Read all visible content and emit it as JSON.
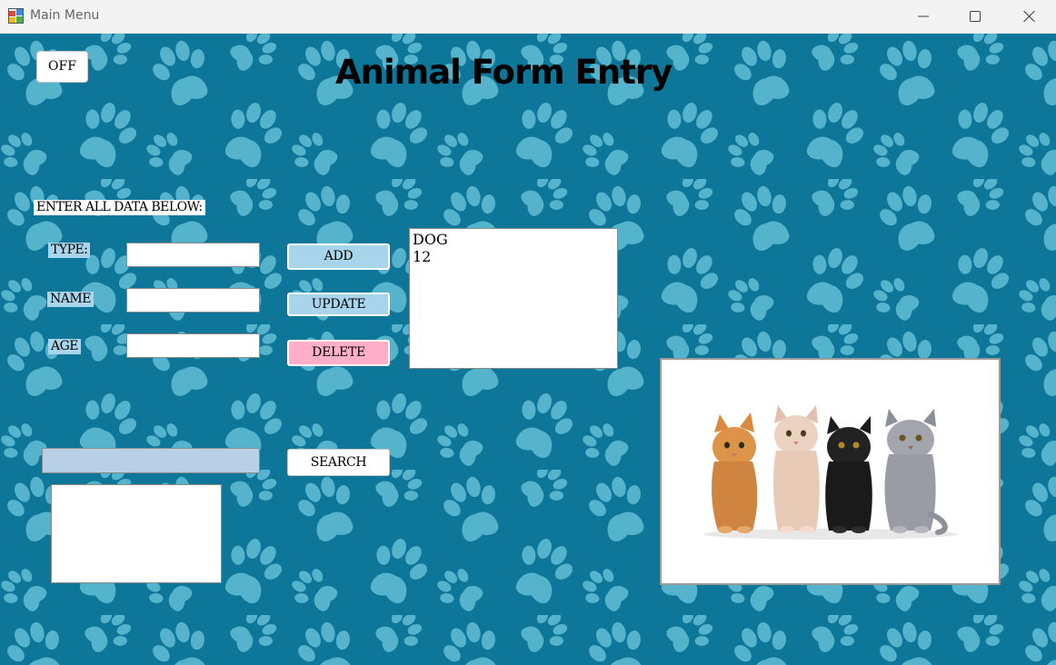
{
  "window": {
    "title": "Main Menu",
    "app_icon": "winforms-app-icon",
    "controls": [
      "minimize-icon",
      "maximize-icon",
      "close-icon"
    ]
  },
  "form": {
    "heading": "Animal Form Entry",
    "off_label": "OFF",
    "instruction": "ENTER ALL DATA BELOW:",
    "labels": {
      "type": "TYPE:",
      "name": "NAME",
      "age": "AGE"
    },
    "fields": {
      "type": "",
      "name": "",
      "age": ""
    },
    "buttons": {
      "add": "ADD",
      "update": "UPDATE",
      "delete": "DELETE",
      "search": "SEARCH"
    },
    "list_items": [
      "DOG",
      "12"
    ],
    "search_value": "",
    "picture": "kittens-photo"
  },
  "colors": {
    "background": "#0d7699",
    "paw": "#55b3cb",
    "label_bg": "#a8d5ec",
    "button_primary": "#a8d5ec",
    "button_delete": "#ffafc8",
    "search_input": "#b8cfe8"
  }
}
